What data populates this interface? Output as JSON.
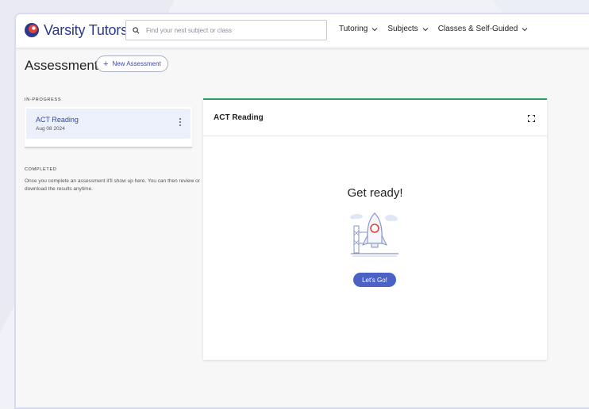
{
  "header": {
    "logo_text": "Varsity Tutors",
    "search_placeholder": "Find your next subject or class",
    "nav": [
      {
        "label": "Tutoring"
      },
      {
        "label": "Subjects"
      },
      {
        "label": "Classes & Self-Guided"
      }
    ]
  },
  "page": {
    "title": "Assessments",
    "new_button_label": "New Assessment"
  },
  "sidebar": {
    "in_progress_label": "IN-PROGRESS",
    "in_progress_items": [
      {
        "title": "ACT Reading",
        "date": "Aug 08 2024"
      }
    ],
    "completed_label": "COMPLETED",
    "completed_text": "Once you complete an assessment it'll show up here. You can then review or download the results anytime."
  },
  "panel": {
    "title": "ACT Reading",
    "heading": "Get ready!",
    "start_button_label": "Let's Go!"
  },
  "colors": {
    "brand_blue": "#2b3a8c",
    "accent_red": "#e0443c",
    "panel_accent_green": "#2e9e6d",
    "button_blue": "#4a62c6",
    "card_highlight": "#ecf0fa"
  }
}
